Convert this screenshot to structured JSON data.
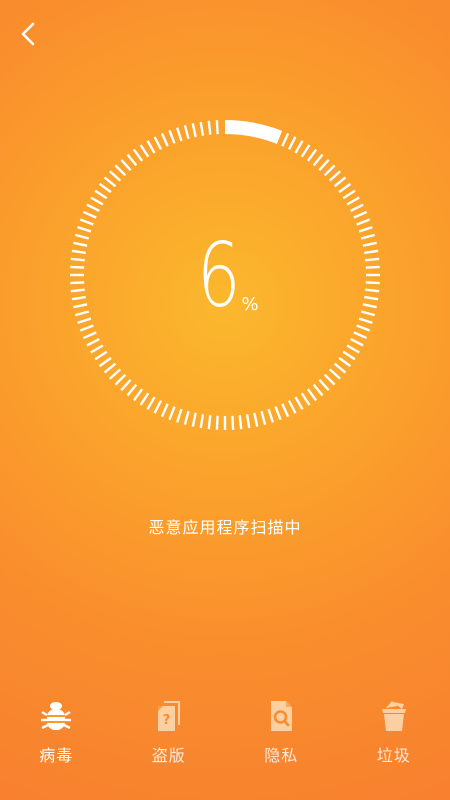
{
  "header": {
    "back_icon": "chevron-left-icon"
  },
  "scan": {
    "progress": 6,
    "percent_value": "6",
    "percent_symbol": "%",
    "status_text": "恶意应用程序扫描中"
  },
  "tabs": [
    {
      "label": "病毒",
      "icon": "bug-icon",
      "active": true
    },
    {
      "label": "盗版",
      "icon": "pirated-files-icon",
      "active": false
    },
    {
      "label": "隐私",
      "icon": "privacy-search-icon",
      "active": false
    },
    {
      "label": "垃圾",
      "icon": "trash-icon",
      "active": false
    }
  ],
  "colors": {
    "accent": "#ffffff",
    "background_center": "#fbb82d",
    "background_edge": "#f8802f"
  }
}
